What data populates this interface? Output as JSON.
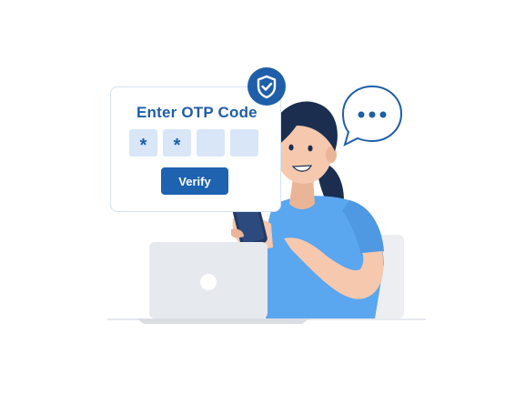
{
  "otp_card": {
    "title": "Enter OTP Code",
    "digits": [
      "*",
      "*",
      "",
      ""
    ],
    "verify_label": "Verify"
  },
  "badge": {
    "icon": "shield-check-icon"
  },
  "speech_bubble": {
    "icon": "ellipsis-icon"
  },
  "colors": {
    "primary_blue": "#1f5ea8",
    "shirt_blue": "#5aa6ef",
    "input_fill": "#d8e6f8",
    "hair": "#1b2e4f",
    "skin": "#f6c8ae",
    "laptop": "#e6e9ee"
  }
}
